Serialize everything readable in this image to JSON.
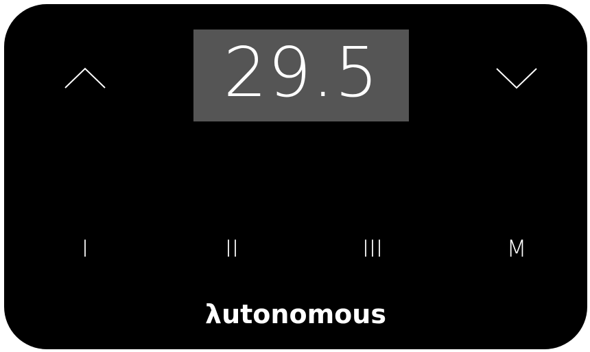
{
  "display": {
    "value": "29.5"
  },
  "controls": {
    "up_icon": "chevron-up-icon",
    "down_icon": "chevron-down-icon",
    "presets": [
      "I",
      "II",
      "III",
      "M"
    ]
  },
  "brand": {
    "logo_text": "λutonomous"
  },
  "colors": {
    "panel": "#000000",
    "display_bg": "#555555",
    "text": "#ffffff"
  }
}
